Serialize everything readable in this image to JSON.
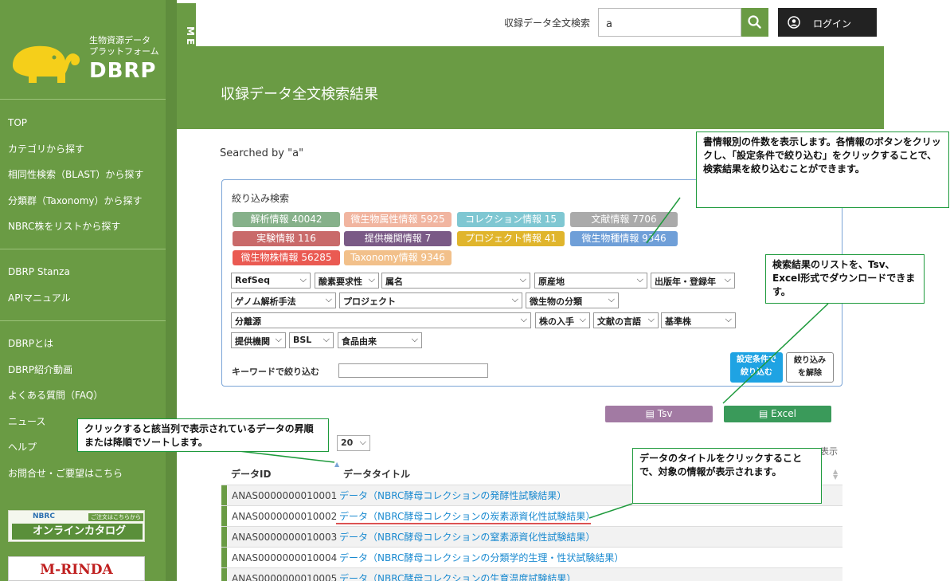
{
  "sidebar": {
    "logo_subtitle_line1": "生物資源データ",
    "logo_subtitle_line2": "プラットフォーム",
    "logo_brand": "DBRP",
    "menu_tab": "MENU",
    "nav_group1": [
      "TOP",
      "カテゴリから探す",
      "相同性検索（BLAST）から探す",
      "分類群（Taxonomy）から探す",
      "NBRC株をリストから探す"
    ],
    "nav_group2": [
      "DBRP Stanza",
      "APIマニュアル"
    ],
    "nav_group3": [
      "DBRPとは",
      "DBRP紹介動画",
      "よくある質問（FAQ）",
      "ニュース",
      "ヘルプ",
      "お問合せ・ご要望はこちら"
    ],
    "banner_nbrc_small": "NBRC",
    "banner_nbrc_tag": "ご注文はこちらから",
    "banner_nbrc_main": "オンラインカタログ",
    "banner_mrinda": "M-RINDA"
  },
  "topbar": {
    "search_label": "収録データ全文検索",
    "search_value": "a",
    "login_label": "ログイン"
  },
  "page_title": "収録データ全文検索結果",
  "searched_by": "Searched by \"a\"",
  "filter": {
    "title": "絞り込み検索",
    "chips": [
      {
        "label": "解析情報 40042",
        "color": "#86b18a"
      },
      {
        "label": "微生物属性情報 5925",
        "color": "#f1b5a0"
      },
      {
        "label": "コレクション情報 15",
        "color": "#7fc7d2"
      },
      {
        "label": "文献情報 7706",
        "color": "#aaaaaa"
      },
      {
        "label": "実験情報 116",
        "color": "#c96a6a"
      },
      {
        "label": "提供機関情報 7",
        "color": "#7a5a86"
      },
      {
        "label": "プロジェクト情報 41",
        "color": "#e0b52c"
      },
      {
        "label": "微生物種情報 9346",
        "color": "#6f9fd8"
      },
      {
        "label": "微生物株情報 56285",
        "color": "#ea5a52"
      },
      {
        "label": "Taxonomy情報 9346",
        "color": "#f2c08a"
      }
    ],
    "selects": [
      "RefSeq",
      "酸素要求性",
      "属名",
      "原産地",
      "出版年・登録年",
      "ゲノム解析手法",
      "プロジェクト",
      "微生物の分類",
      "分離源",
      "株の入手",
      "文献の言語",
      "基準株",
      "提供機関",
      "BSL",
      "食品由来"
    ],
    "keyword_label": "キーワードで絞り込む",
    "keyword_value": "",
    "apply_line1": "設定条件で",
    "apply_line2": "絞り込む",
    "clear_line1": "絞り込み",
    "clear_line2": "を解除"
  },
  "download": {
    "tsv_label": "Tsv",
    "excel_label": "Excel",
    "tsv_color": "#a27aa3",
    "excel_color": "#3a9a5a"
  },
  "pagination": {
    "per_page": "20",
    "trailing_text": "表示"
  },
  "table": {
    "col_id": "データID",
    "col_title": "データタイトル",
    "rows": [
      {
        "id": "ANAS0000000010001",
        "title": "データ（NBRC酵母コレクションの発酵性試験結果）"
      },
      {
        "id": "ANAS0000000010002",
        "title": "データ（NBRC酵母コレクションの炭素源資化性試験結果）"
      },
      {
        "id": "ANAS0000000010003",
        "title": "データ（NBRC酵母コレクションの窒素源資化性試験結果）"
      },
      {
        "id": "ANAS0000000010004",
        "title": "データ（NBRC酵母コレクションの分類学的生理・性状試験結果）"
      },
      {
        "id": "ANAS0000000010005",
        "title": "データ（NBRC酵母コレクションの生育温度試験結果）"
      }
    ]
  },
  "callouts": {
    "filter_note": "書情報別の件数を表示します。各情報のボタンをクリックし、「設定条件で絞り込む」をクリックすることで、検索結果を絞り込むことができます。",
    "download_note": "検索結果のリストを、Tsv、Excel形式でダウンロードできます。",
    "sort_note": "クリックすると該当列で表示されているデータの昇順または降順でソートします。",
    "title_note": "データのタイトルをクリックすることで、対象の情報が表示されます。"
  },
  "colors": {
    "sidebar_green": "#6a9b44",
    "callout_border": "#1e9a3c",
    "link_blue": "#1a8ad0"
  }
}
